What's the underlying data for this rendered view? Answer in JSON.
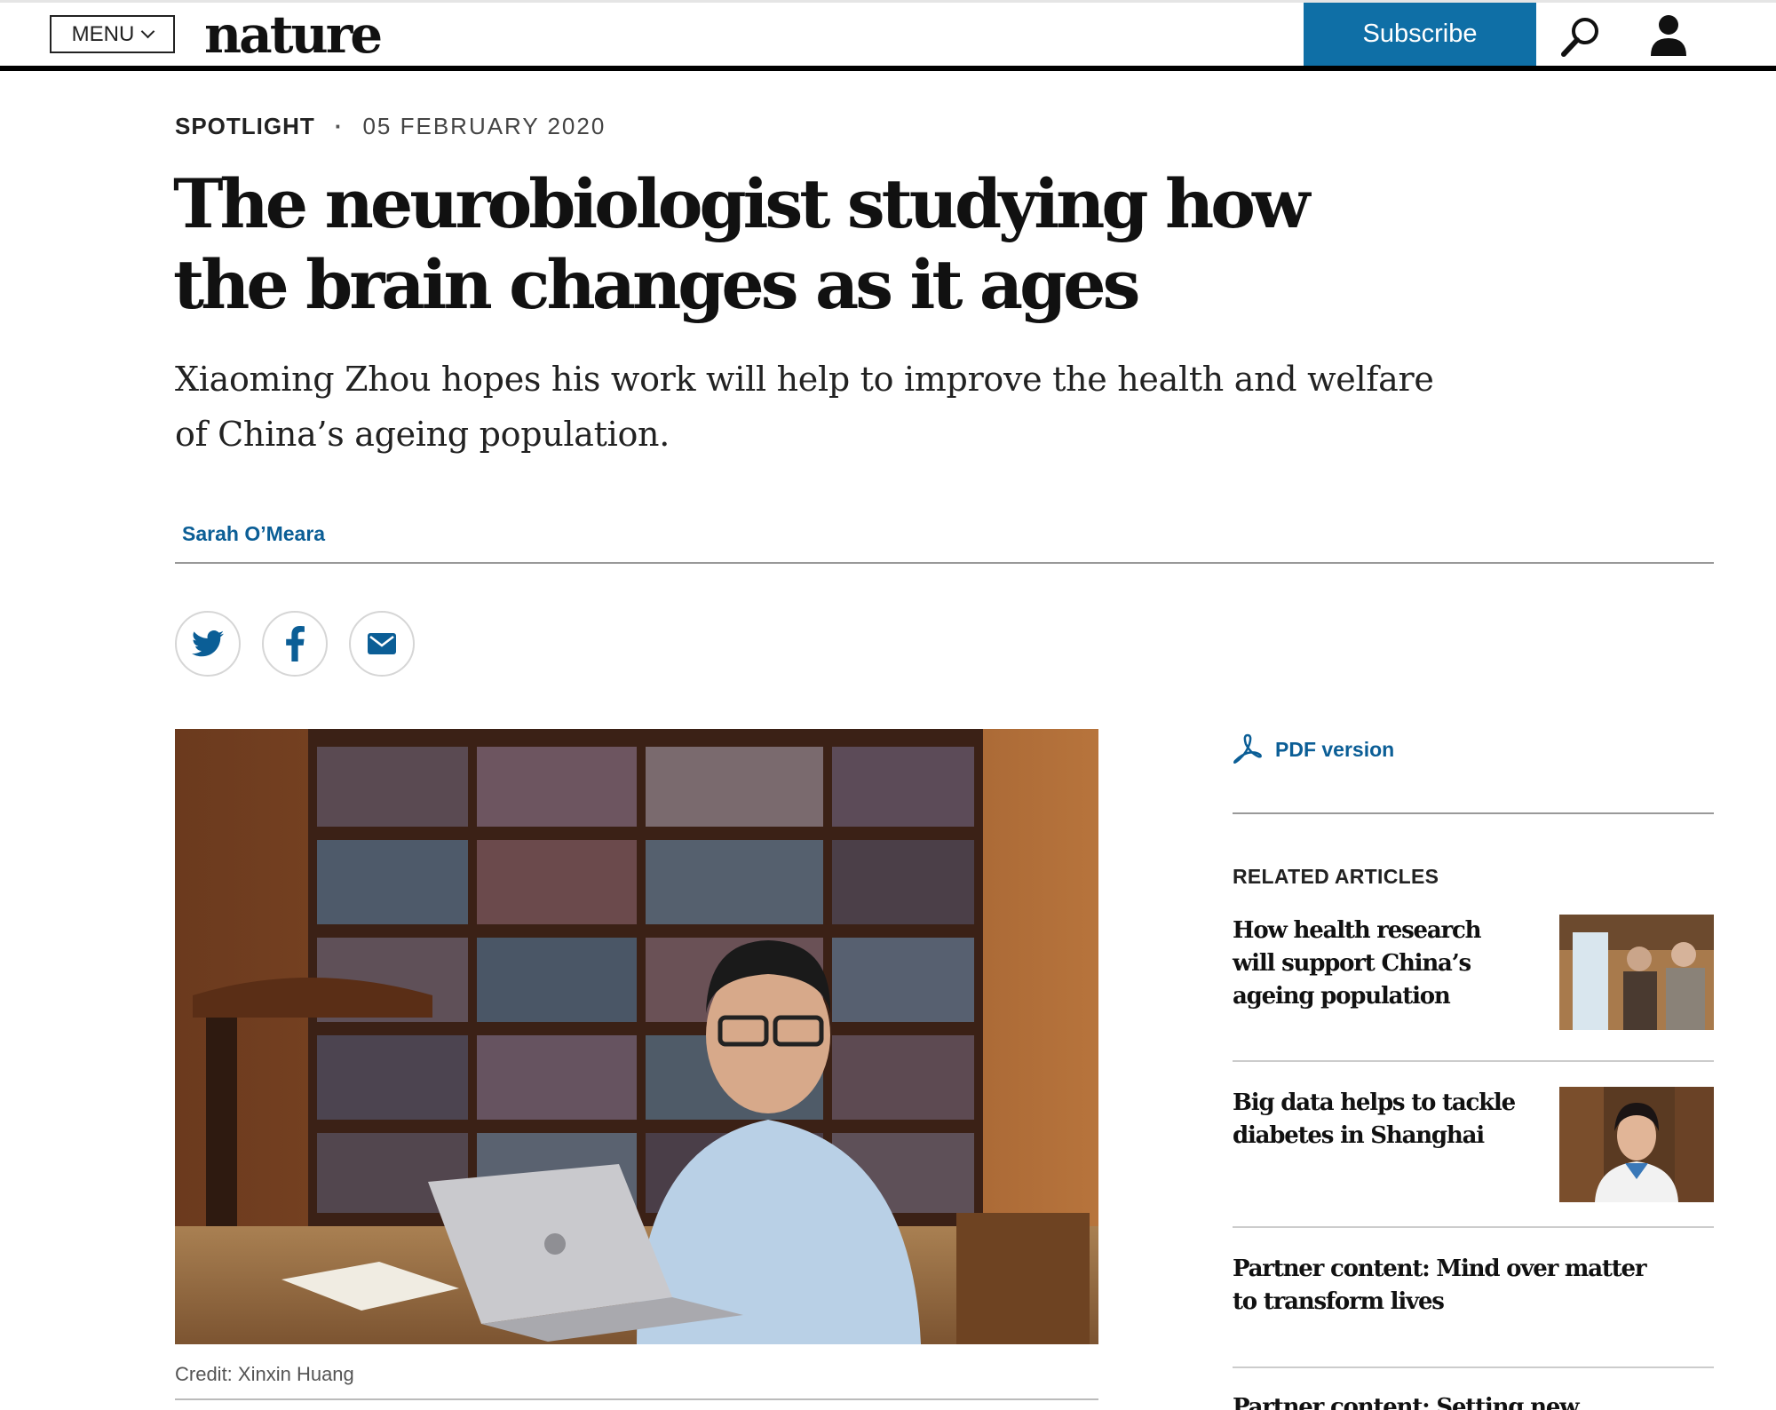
{
  "header": {
    "menu_label": "MENU",
    "logo": "nature",
    "subscribe_label": "Subscribe"
  },
  "article": {
    "type": "SPOTLIGHT",
    "separator": "·",
    "date": "05 FEBRUARY 2020",
    "title": "The neurobiologist studying how the brain changes as it ages",
    "standfirst": "Xiaoming Zhou hopes his work will help to improve the health and welfare of China’s ageing population.",
    "author": "Sarah O’Meara",
    "share": [
      "twitter-icon",
      "facebook-icon",
      "email-icon"
    ],
    "figure_credit": "Credit: Xinxin Huang"
  },
  "sidebar": {
    "pdf_label": "PDF version",
    "related_heading": "RELATED ARTICLES",
    "related": [
      {
        "title": "How health research will support China’s ageing population"
      },
      {
        "title": "Big data helps to tackle diabetes in Shanghai"
      },
      {
        "title": "Partner content: Mind over matter to transform lives"
      },
      {
        "title": "Partner content: Setting new patterns in"
      }
    ]
  },
  "colors": {
    "accent": "#0f6fa6",
    "link": "#0b5e96"
  }
}
